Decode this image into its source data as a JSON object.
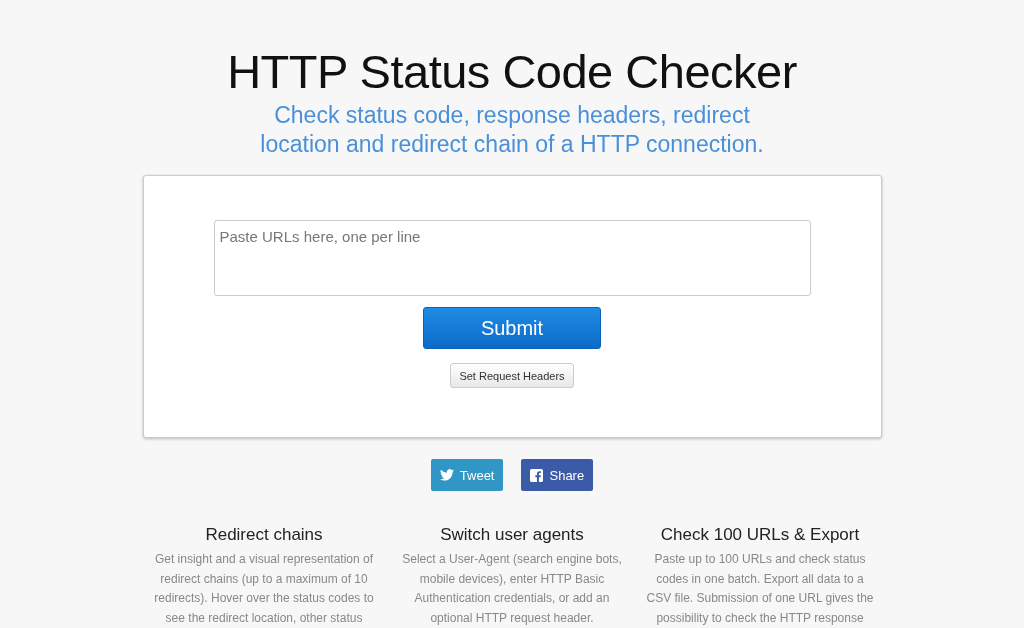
{
  "title": "HTTP Status Code Checker",
  "subtitle": "Check status code, response headers, redirect location and redirect chain of a HTTP connection.",
  "form": {
    "placeholder": "Paste URLs here, one per line",
    "submit": "Submit",
    "headers_button": "Set Request Headers"
  },
  "share": [
    {
      "kind": "twitter",
      "label": "Tweet"
    },
    {
      "kind": "facebook",
      "label": "Share"
    }
  ],
  "features": [
    {
      "title": "Redirect chains",
      "lines": [
        "Get insight and a visual representation of",
        "redirect chains (up to a maximum of 10",
        "redirects). Hover over the status codes to",
        "see the redirect location, other status"
      ]
    },
    {
      "title": "Switch user agents",
      "lines": [
        "Select a User-Agent (search engine bots,",
        "mobile devices), enter HTTP Basic",
        "Authentication credentials, or add an",
        "optional HTTP request header."
      ]
    },
    {
      "title": "Check 100 URLs & Export",
      "lines": [
        "Paste up to 100 URLs and check status",
        "codes in one batch. Export all data to a",
        "CSV file. Submission of one URL gives the",
        "possibility to check the HTTP response"
      ]
    }
  ]
}
